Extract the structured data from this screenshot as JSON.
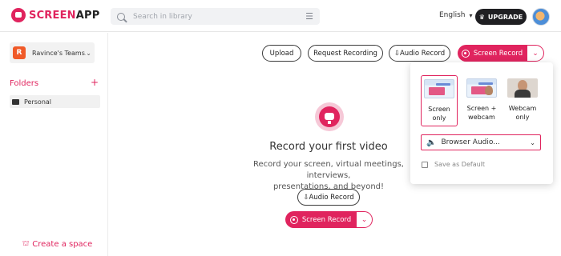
{
  "header": {
    "logo_text_a": "SCREEN",
    "logo_text_b": "APP",
    "search_placeholder": "Search in library",
    "language": "English",
    "upgrade_label": "UPGRADE"
  },
  "sidebar": {
    "team_initial": "R",
    "team_name": "Ravince's Teams...",
    "folders_label": "Folders",
    "folders": [
      {
        "label": "Personal"
      }
    ],
    "create_space_label": "Create a space"
  },
  "toolbar": {
    "upload_label": "Upload",
    "request_label": "Request Recording",
    "audio_record_label": "Audio Record",
    "screen_record_label": "Screen Record"
  },
  "empty_state": {
    "title": "Record your first video",
    "description_line1": "Record your screen, virtual meetings, interviews,",
    "description_line2": "presentations, and beyond!",
    "audio_record_label": "Audio Record",
    "screen_record_label": "Screen Record"
  },
  "record_panel": {
    "modes": [
      {
        "line1": "Screen",
        "line2": "only",
        "selected": true
      },
      {
        "line1": "Screen +",
        "line2": "webcam",
        "selected": false
      },
      {
        "line1": "Webcam",
        "line2": "only",
        "selected": false
      }
    ],
    "audio_value": "Browser Audio...",
    "save_default_label": "Save as Default"
  },
  "colors": {
    "brand": "#e0245e",
    "dark": "#1f1f22"
  },
  "icons": [
    "logo-icon",
    "search-icon",
    "filter-icon",
    "chevron-down-icon",
    "crown-icon",
    "plus-icon",
    "folder-icon",
    "space-icon",
    "microphone-icon",
    "record-icon",
    "speaker-icon",
    "checkbox-icon"
  ]
}
